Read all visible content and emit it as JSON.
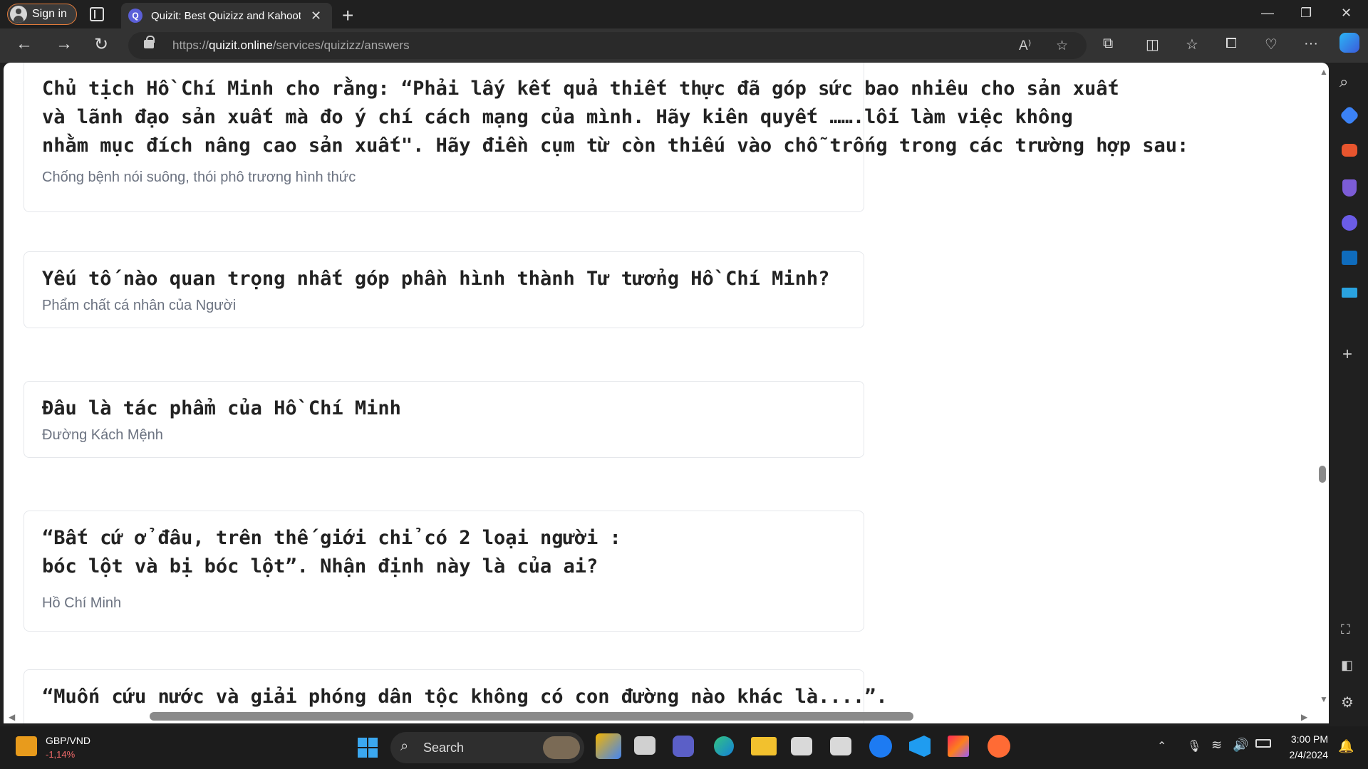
{
  "browser": {
    "signin_label": "Sign in",
    "tab_title": "Quizit: Best Quizizz and Kahoot C",
    "url_prefix": "https://",
    "url_host": "quizit.online",
    "url_path": "/services/quizizz/answers"
  },
  "cards": [
    {
      "question": "Chủ tịch Hồ Chí Minh cho rằng: “Phải lấy kết quả thiết thực đã góp sức bao nhiêu cho sản xuất\nvà lãnh đạo sản xuất mà đo ý chí cách mạng của mình. Hãy kiên quyết …….lối làm việc không\nnhằm mục đích nâng cao sản xuất\". Hãy điền cụm từ còn thiếu vào chỗ trống trong các trường hợp sau:",
      "answer": "Chống bệnh nói suông, thói phô trương hình thức"
    },
    {
      "question": "Yếu tố nào quan trọng nhất góp phần hình thành Tư tưởng Hồ Chí Minh?",
      "answer": "Phẩm chất cá nhân của Người"
    },
    {
      "question": "Đâu là tác phẩm của Hồ Chí Minh",
      "answer": "Đường Kách Mệnh"
    },
    {
      "question": "“Bất cứ ở đâu, trên thế giới chỉ có 2 loại người :\nbóc lột và bị bóc lột”. Nhận định này là của ai?",
      "answer": "Hồ Chí Minh"
    },
    {
      "question": "“Muốn cứu nước và giải phóng dân tộc không có con đường nào khác là....”.",
      "answer": ""
    }
  ],
  "taskbar": {
    "ticker_name": "GBP/VND",
    "ticker_change": "-1,14%",
    "search_label": "Search",
    "time": "3:00 PM",
    "date": "2/4/2024"
  }
}
